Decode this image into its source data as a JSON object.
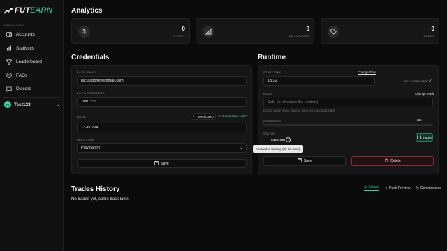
{
  "brand": {
    "name_prefix": "FUT",
    "name_suffix": "EARN",
    "accent": "#3fd1a5"
  },
  "sidebar": {
    "section_label": "NAVIGATION",
    "items": [
      {
        "label": "Accounts",
        "icon": "wallet-icon"
      },
      {
        "label": "Statistics",
        "icon": "bar-chart-icon"
      },
      {
        "label": "Leaderboard",
        "icon": "trophy-icon"
      },
      {
        "label": "FAQs",
        "icon": "help-circle-icon"
      },
      {
        "label": "Discord",
        "icon": "chat-icon"
      }
    ],
    "user": {
      "initials": "TE",
      "name": "Test123"
    }
  },
  "analytics": {
    "title": "Analytics",
    "stats": [
      {
        "value": "0",
        "label": "PROFIT",
        "icon": "dollar-icon"
      },
      {
        "value": "0",
        "label": "BUY VOLUME",
        "icon": "triangle-chart-icon"
      },
      {
        "value": "0",
        "label": "TRADES",
        "icon": "tag-icon"
      }
    ]
  },
  "credentials": {
    "title": "Credentials",
    "email_label": "EA FC EMAIL",
    "email_value": "racutadonefw@mail.com",
    "password_label": "EA FC PASSWORD",
    "password_value": "Test123!",
    "code_label": "CODE",
    "send_code_label": "Send code?",
    "or_text": "or",
    "backup_code_label": "Get backup code?",
    "code_value": "73260794",
    "platform_label": "PLATFORM",
    "platform_value": "Playstation",
    "save_label": "Save"
  },
  "runtime": {
    "title": "Runtime",
    "start_time_label": "START TIME",
    "change_time_label": "Change Time",
    "start_time_value": "13:32",
    "pack_preview_label": "PACK PREVIEW",
    "pack_preview_checked": true,
    "mode_label": "MODE",
    "change_mode_label": "Change Mode",
    "mode_value": "Safe (AI chooses the runtime)",
    "mode_hint": "Do not touch if you want to keep your account safe!",
    "progress_label": "PROGRESS",
    "progress_value": "0%",
    "progress_fraction": 0,
    "status_label": "STATUS",
    "status_value": "STARTING",
    "pause_label": "Pause",
    "tooltip_text": "Account is starting (30-60 secs).",
    "save_label": "Save",
    "delete_label": "Delete"
  },
  "trades": {
    "title": "Trades History",
    "tabs": [
      {
        "label": "Snipes",
        "icon": "target-icon"
      },
      {
        "label": "Pack Preview",
        "icon": "star-icon"
      },
      {
        "label": "Commissions",
        "icon": "percent-icon"
      }
    ],
    "empty_text": "No trades yet, come back later."
  }
}
